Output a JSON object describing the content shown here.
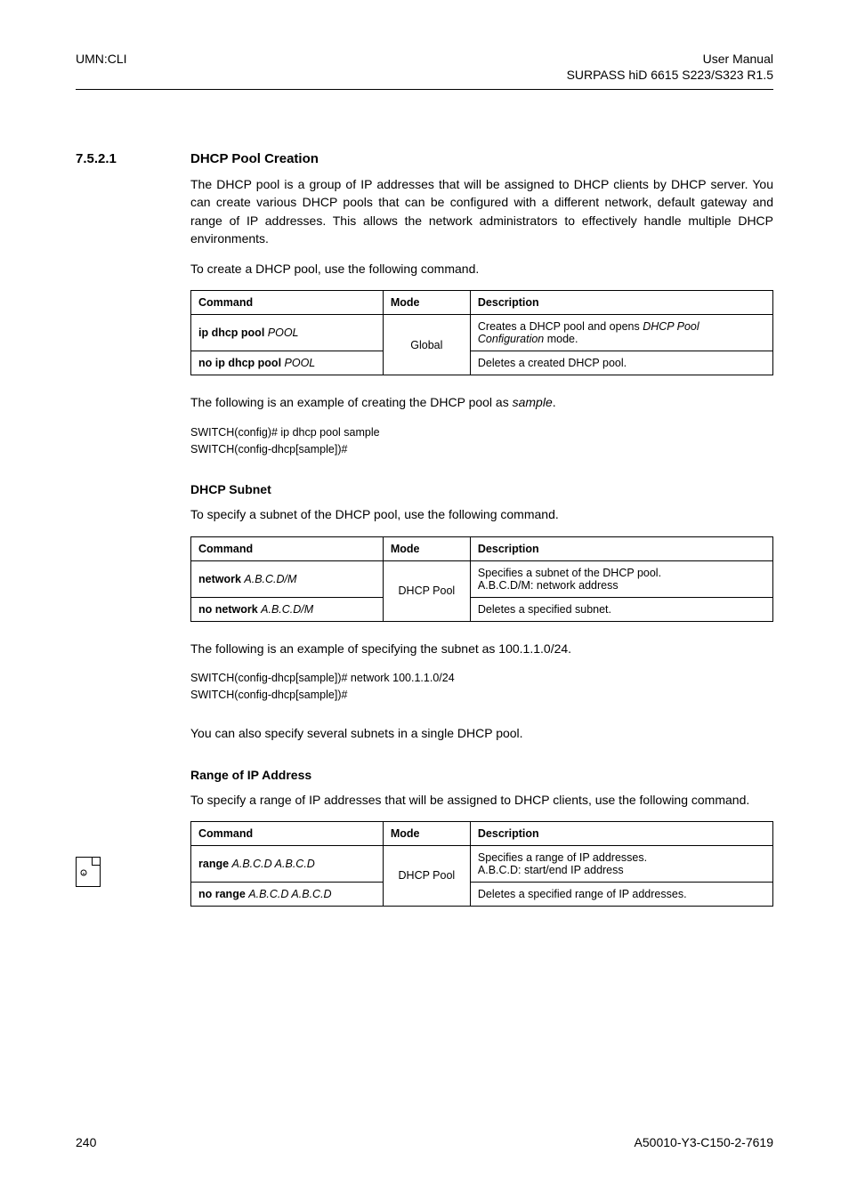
{
  "header": {
    "left": "UMN:CLI",
    "right_line1": "User Manual",
    "right_line2": "SURPASS hiD 6615 S223/S323 R1.5"
  },
  "section_number": "7.5.2.1",
  "section_title": "DHCP Pool Creation",
  "intro_para": "The DHCP pool is a group of IP addresses that will be assigned to DHCP clients by DHCP server. You can create various DHCP pools that can be configured with a different network, default gateway and range of IP addresses. This allows the network administrators to effectively handle multiple DHCP environments.",
  "create_intro": "To create a DHCP pool, use the following command.",
  "table_headers": {
    "command": "Command",
    "mode": "Mode",
    "description": "Description"
  },
  "table_create": {
    "mode": "Global",
    "rows": [
      {
        "cmd_plain": "ip dhcp pool ",
        "cmd_italic": "POOL",
        "desc_line1": "Creates a DHCP pool and opens ",
        "desc_italic": "DHCP Pool Configuration",
        "desc_line2": " mode."
      },
      {
        "cmd_plain": "no ip dhcp pool ",
        "cmd_italic": "POOL",
        "desc": "Deletes a created DHCP pool."
      }
    ]
  },
  "example1_intro_pre": "The following is an example of creating the DHCP pool as ",
  "example1_intro_italic": "sample",
  "example1_intro_post": ".",
  "example1_lines": [
    "SWITCH(config)# ip dhcp pool sample",
    "SWITCH(config-dhcp[sample])#"
  ],
  "sub2_title": "DHCP Subnet",
  "sub2_intro": "To specify a subnet of the DHCP pool, use the following command.",
  "table_subnet": {
    "mode": "DHCP Pool",
    "rows": [
      {
        "cmd_plain": "network ",
        "cmd_italic": "A.B.C.D/M",
        "desc_line1": "Specifies a subnet of the DHCP pool.",
        "desc_line2": "A.B.C.D/M: network address"
      },
      {
        "cmd_plain": "no network ",
        "cmd_italic": "A.B.C.D/M",
        "desc": "Deletes a specified subnet."
      }
    ]
  },
  "example2_intro": "The following is an example of specifying the subnet as 100.1.1.0/24.",
  "example2_lines": [
    "SWITCH(config-dhcp[sample])# network 100.1.1.0/24",
    "SWITCH(config-dhcp[sample])#"
  ],
  "note_text": "You can also specify several subnets in a single DHCP pool.",
  "sub3_title": "Range of IP Address",
  "sub3_intro": "To specify a range of IP addresses that will be assigned to DHCP clients, use the following command.",
  "table_range": {
    "mode": "DHCP Pool",
    "rows": [
      {
        "cmd_plain": "range ",
        "cmd_italic": "A.B.C.D A.B.C.D",
        "desc_line1": "Specifies a range of IP addresses.",
        "desc_line2": "A.B.C.D: start/end IP address"
      },
      {
        "cmd_plain": "no range ",
        "cmd_italic": "A.B.C.D A.B.C.D",
        "desc": "Deletes a specified range of IP addresses."
      }
    ]
  },
  "footer": {
    "page": "240",
    "doc_id": "A50010-Y3-C150-2-7619"
  }
}
